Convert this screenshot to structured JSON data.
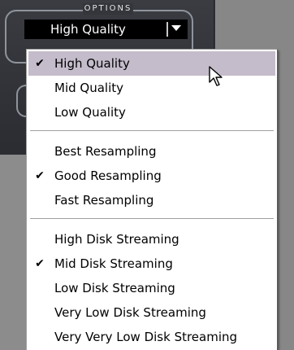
{
  "panel": {
    "options_label": "OPTIONS",
    "selected_value": "High Quality"
  },
  "menu": {
    "groups": [
      {
        "name": "quality",
        "items": [
          {
            "label": "High Quality",
            "checked": true,
            "highlighted": true
          },
          {
            "label": "Mid Quality",
            "checked": false
          },
          {
            "label": "Low Quality",
            "checked": false
          }
        ]
      },
      {
        "name": "resampling",
        "items": [
          {
            "label": "Best Resampling",
            "checked": false
          },
          {
            "label": "Good Resampling",
            "checked": true
          },
          {
            "label": "Fast Resampling",
            "checked": false
          }
        ]
      },
      {
        "name": "disk-streaming",
        "items": [
          {
            "label": "High Disk Streaming",
            "checked": false
          },
          {
            "label": "Mid Disk Streaming",
            "checked": true
          },
          {
            "label": "Low Disk Streaming",
            "checked": false
          },
          {
            "label": "Very Low Disk Streaming",
            "checked": false
          },
          {
            "label": "Very Very Low Disk Streaming",
            "checked": false
          }
        ]
      }
    ],
    "check_glyph": "✔"
  },
  "colors": {
    "highlight": "#c4bccb",
    "panel_dark": "#2b2d33",
    "select_bg": "#000000"
  }
}
